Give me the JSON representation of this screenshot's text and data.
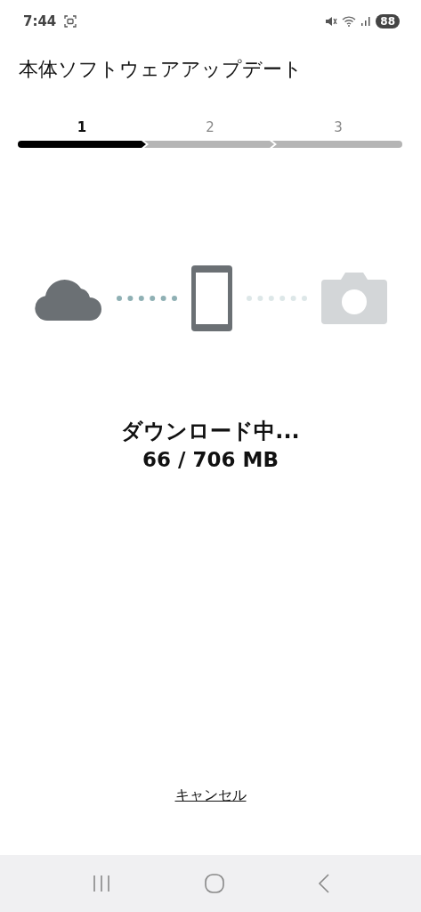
{
  "status_bar": {
    "time": "7:44",
    "battery": "88"
  },
  "title": "本体ソフトウェアアップデート",
  "steps": [
    {
      "label": "1",
      "selected": true
    },
    {
      "label": "2",
      "selected": false
    },
    {
      "label": "3",
      "selected": false
    }
  ],
  "transfer_links": [
    {
      "active": true
    },
    {
      "active": false
    }
  ],
  "status": {
    "message": "ダウンロード中...",
    "progress": "66 / 706 MB"
  },
  "cancel_link": "キャンセル"
}
